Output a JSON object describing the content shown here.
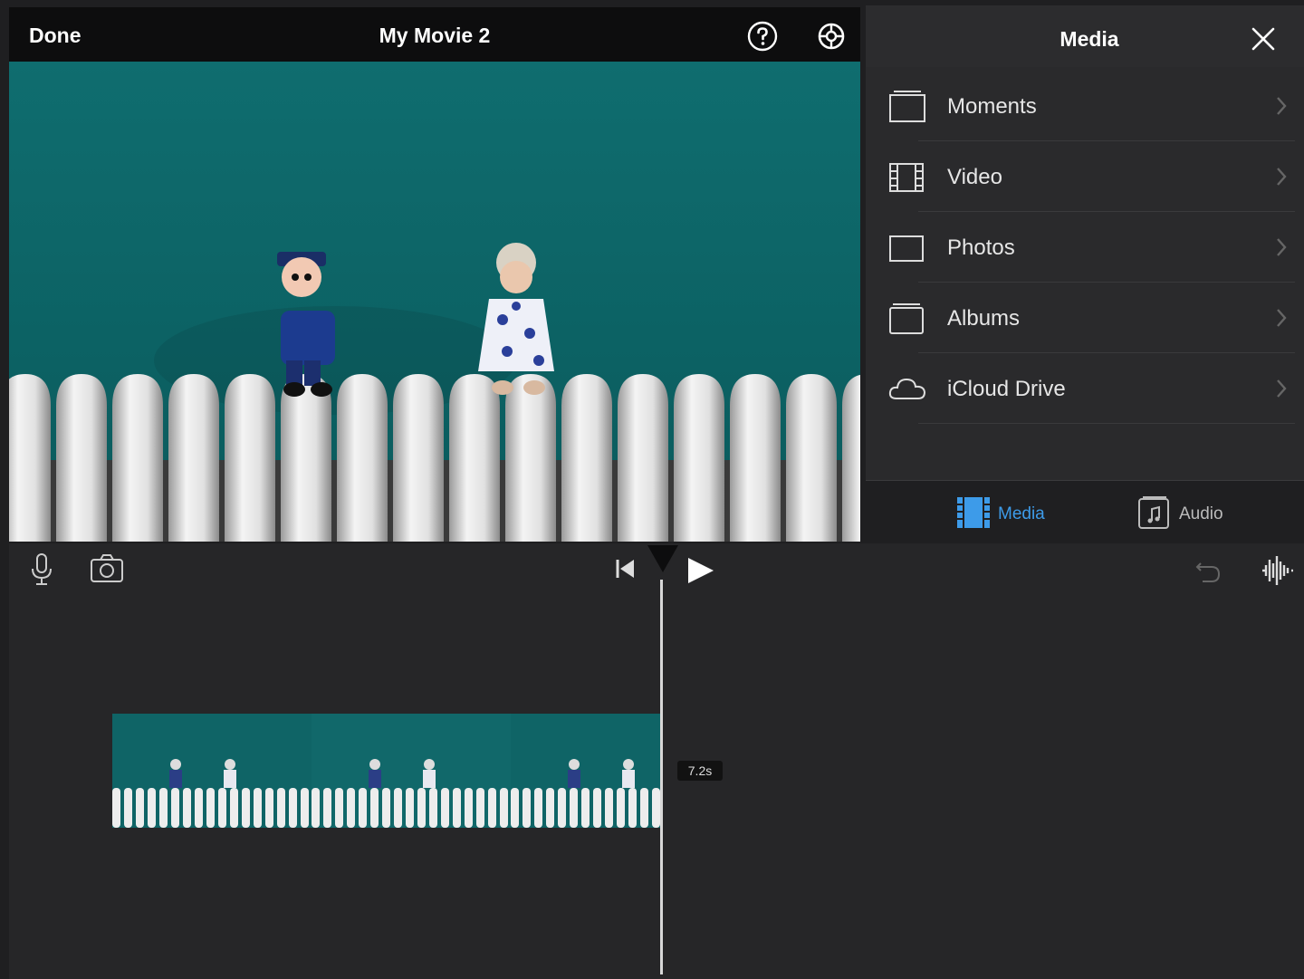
{
  "app": {
    "done_label": "Done",
    "project_title": "My Movie 2",
    "help_icon": "help-circle-icon",
    "settings_icon": "settings-gear-icon"
  },
  "media_panel": {
    "title": "Media",
    "close_icon": "close-icon",
    "items": [
      {
        "label": "Moments",
        "icon": "moments-icon"
      },
      {
        "label": "Video",
        "icon": "film-icon"
      },
      {
        "label": "Photos",
        "icon": "photos-icon"
      },
      {
        "label": "Albums",
        "icon": "albums-icon"
      },
      {
        "label": "iCloud Drive",
        "icon": "cloud-icon"
      }
    ],
    "tabs": [
      {
        "label": "Media",
        "icon": "media-film-icon",
        "selected": true
      },
      {
        "label": "Audio",
        "icon": "audio-note-icon",
        "selected": false
      }
    ]
  },
  "timeline": {
    "clip_duration": "7.2s"
  },
  "colors": {
    "accent": "#3d9be9",
    "background": "#1f1f21",
    "teal_wall": "#0e6467"
  }
}
